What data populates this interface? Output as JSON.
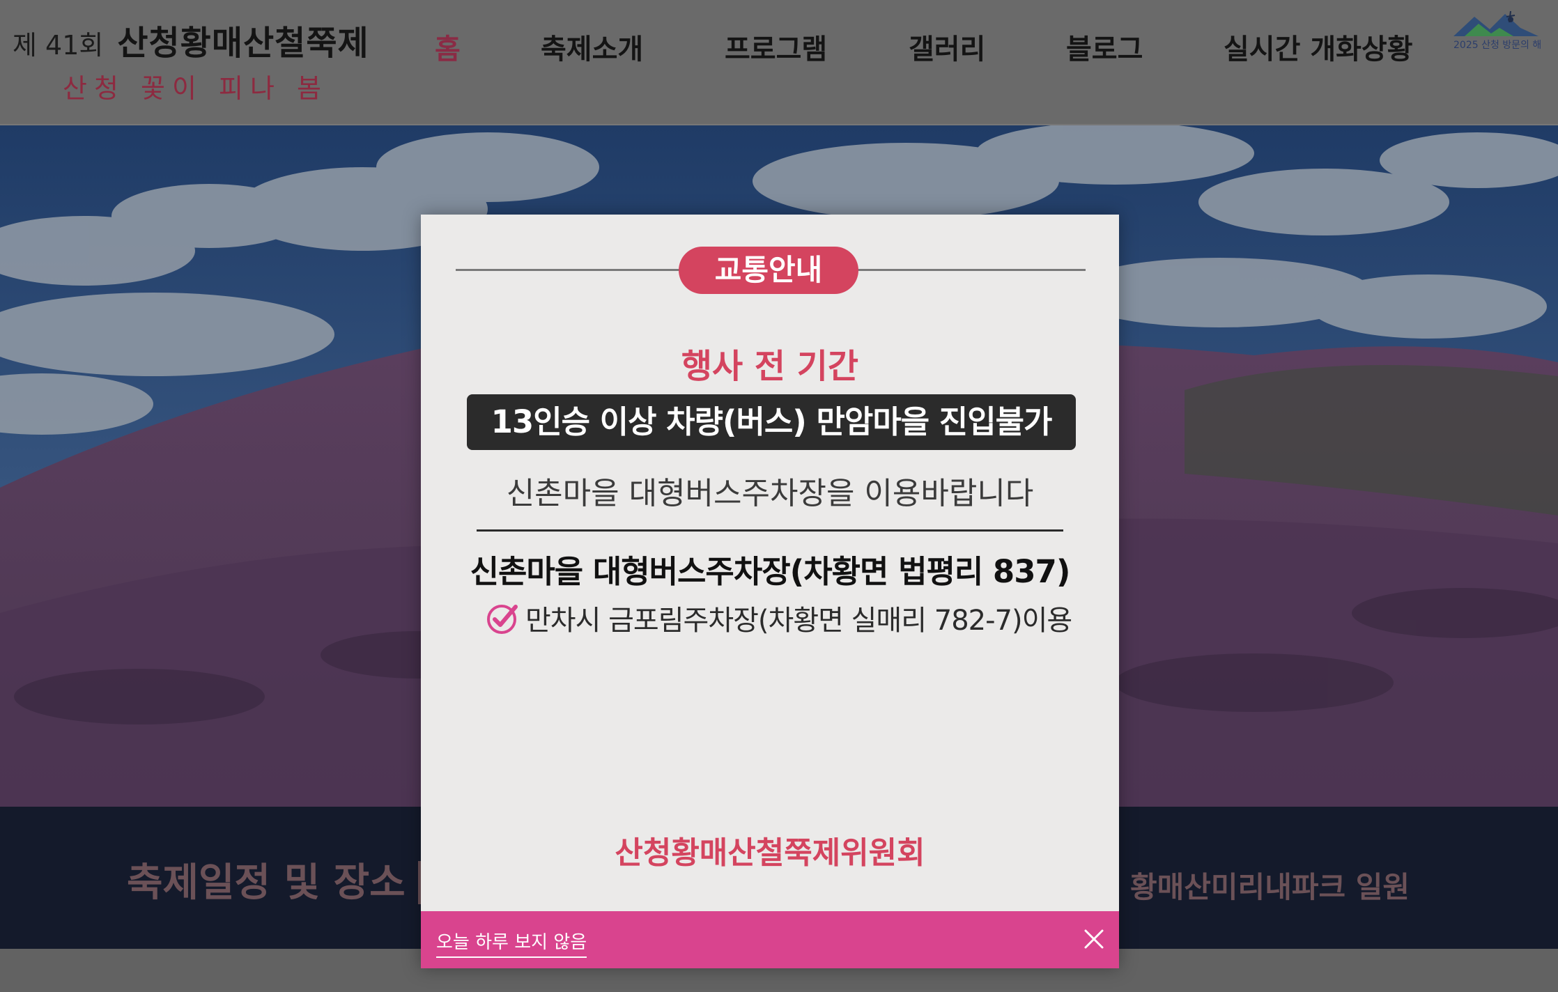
{
  "header": {
    "logo_prefix": "제 41회",
    "logo_name": "산청황매산철쭉제",
    "logo_slogan": "산청 꽃이 피나 봄",
    "badge_text": "2025 산청 방문의 해"
  },
  "nav": {
    "items": [
      {
        "label": "홈",
        "active": true
      },
      {
        "label": "축제소개"
      },
      {
        "label": "프로그램"
      },
      {
        "label": "갤러리"
      },
      {
        "label": "블로그"
      },
      {
        "label": "실시간 개화상황"
      }
    ]
  },
  "info": {
    "label": "축제일정 및 장소",
    "value": "황매산미리내파크 일원"
  },
  "popup": {
    "tag": "교통안내",
    "period": "행사 전 기간",
    "restriction": "13인승 이상 차량(버스) 만암마을 진입불가",
    "advice": "신촌마을 대형버스주차장을 이용바랍니다",
    "parking_main": "신촌마을 대형버스주차장(차황면 법평리 837)",
    "parking_alt": "만차시 금포림주차장(차황면 실매리 782-7)이용",
    "committee": "산청황매산철쭉제위원회",
    "dismiss": "오늘 하루 보지 않음"
  },
  "colors": {
    "accent_pink": "#d4445f",
    "footer_magenta": "#d9448e",
    "navy": "#141a2b"
  }
}
